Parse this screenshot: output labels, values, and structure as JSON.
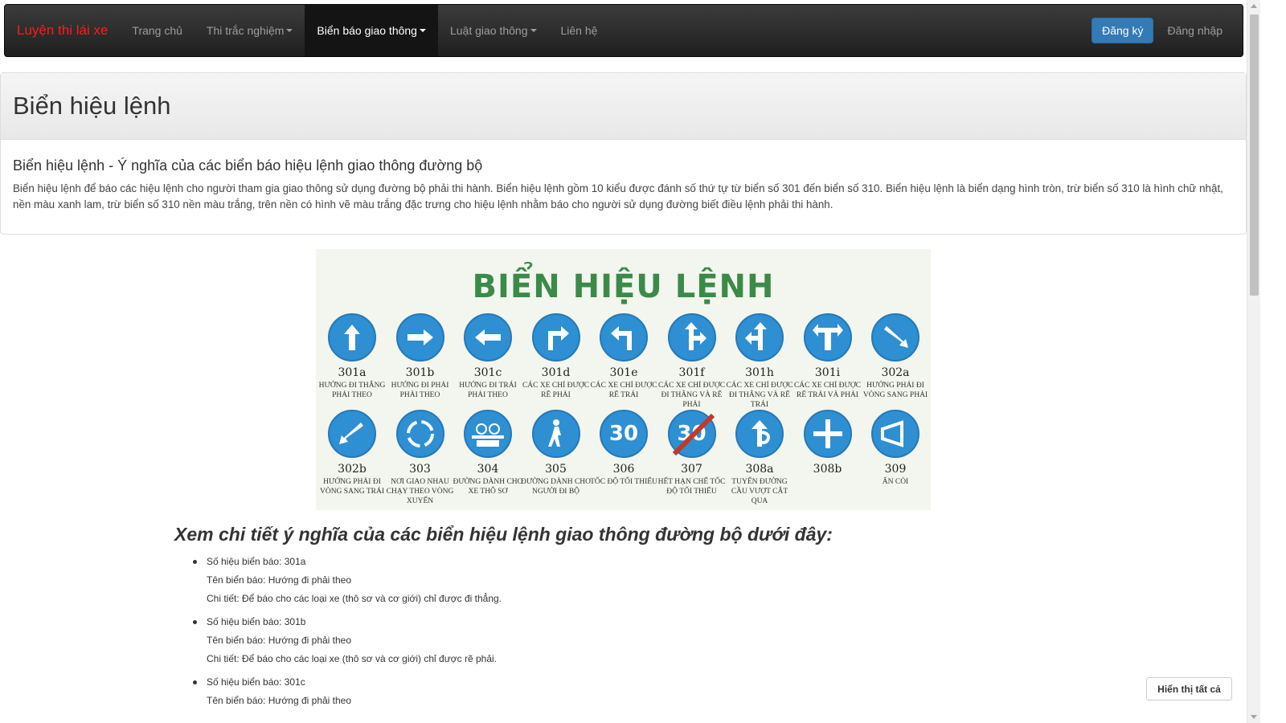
{
  "nav": {
    "brand": "Luyện thi lái xe",
    "items": [
      {
        "label": "Trang chủ",
        "dropdown": false,
        "active": false
      },
      {
        "label": "Thi trắc nghiệm",
        "dropdown": true,
        "active": false
      },
      {
        "label": "Biển báo giao thông",
        "dropdown": true,
        "active": true
      },
      {
        "label": "Luật giao thông",
        "dropdown": true,
        "active": false
      },
      {
        "label": "Liên hệ",
        "dropdown": false,
        "active": false
      }
    ],
    "register": "Đăng ký",
    "login": "Đăng nhập"
  },
  "panel": {
    "title": "Biển hiệu lệnh",
    "subtitle": "Biển hiệu lệnh - Ý nghĩa của các biển báo hiệu lệnh giao thông đường bộ",
    "description": "Biển hiệu lệnh để báo các hiệu lệnh cho người tham gia giao thông sử dụng đường bộ phải thi hành. Biển hiệu lệnh gồm 10 kiểu được đánh số thứ tự từ biển số 301 đến biển số 310. Biển hiệu lệnh là biển dạng hình tròn, trừ biển số 310 là hình chữ nhật, nền màu xanh lam, trừ biển số 310 nền màu trắng, trên nền có hình vẽ màu trắng đặc trưng cho hiệu lệnh nhằm báo cho người sử dụng đường biết điều lệnh phải thi hành."
  },
  "image": {
    "title": "BIỂN HIỆU LỆNH",
    "signs": [
      {
        "code": "301a",
        "desc": "Hướng đi thẳng phải theo",
        "icon": "arrow-up-icon"
      },
      {
        "code": "301b",
        "desc": "Hướng đi phải phải theo",
        "icon": "arrow-right-icon"
      },
      {
        "code": "301c",
        "desc": "Hướng đi trái phải theo",
        "icon": "arrow-left-icon"
      },
      {
        "code": "301d",
        "desc": "Các xe chỉ được rẽ phải",
        "icon": "turn-right-icon"
      },
      {
        "code": "301e",
        "desc": "Các xe chỉ được rẽ trái",
        "icon": "turn-left-icon"
      },
      {
        "code": "301f",
        "desc": "Các xe chỉ được đi thẳng và rẽ phải",
        "icon": "straight-right-icon"
      },
      {
        "code": "301h",
        "desc": "Các xe chỉ được đi thẳng và rẽ trái",
        "icon": "straight-left-icon"
      },
      {
        "code": "301i",
        "desc": "Các xe chỉ được rẽ trái và phải",
        "icon": "left-right-icon"
      },
      {
        "code": "302a",
        "desc": "Hướng phải đi vòng sang phải",
        "icon": "keep-right-icon"
      },
      {
        "code": "302b",
        "desc": "Hướng phải đi vòng sang trái",
        "icon": "keep-left-icon"
      },
      {
        "code": "303",
        "desc": "Nơi giao nhau chạy theo vòng xuyến",
        "icon": "roundabout-icon"
      },
      {
        "code": "304",
        "desc": "Đường dành cho xe thô sơ",
        "icon": "bicycle-icon"
      },
      {
        "code": "305",
        "desc": "Đường dành cho người đi bộ",
        "icon": "pedestrian-icon"
      },
      {
        "code": "306",
        "desc": "Tốc độ tối thiểu",
        "icon": "speed-30-icon"
      },
      {
        "code": "307",
        "desc": "Hết hạn chế tốc độ tối thiểu",
        "icon": "end-speed-30-icon"
      },
      {
        "code": "308a",
        "desc": "Tuyến đường cầu vượt cắt qua",
        "icon": "overpass-icon"
      },
      {
        "code": "308b",
        "desc": "",
        "icon": "overpass-b-icon"
      },
      {
        "code": "309",
        "desc": "Ấn còi",
        "icon": "horn-icon"
      }
    ],
    "speed": "30"
  },
  "section_title": "Xem chi tiết ý nghĩa của các biển hiệu lệnh giao thông đường bộ dưới đây:",
  "items": [
    {
      "number": "Số hiệu biển báo: 301a",
      "name": "Tên biển báo: Hướng đi phải theo",
      "detail": "Chi tiết: Để báo cho các loại xe (thô sơ và cơ giới) chỉ được đi thẳng."
    },
    {
      "number": "Số hiệu biển báo: 301b",
      "name": "Tên biển báo: Hướng đi phải theo",
      "detail": "Chi tiết: Để báo cho các loại xe (thô sơ và cơ giới) chỉ được rẽ phải."
    },
    {
      "number": "Số hiệu biển báo: 301c",
      "name": "Tên biển báo: Hướng đi phải theo",
      "detail": ""
    }
  ],
  "show_all": "Hiển thị tất cả"
}
